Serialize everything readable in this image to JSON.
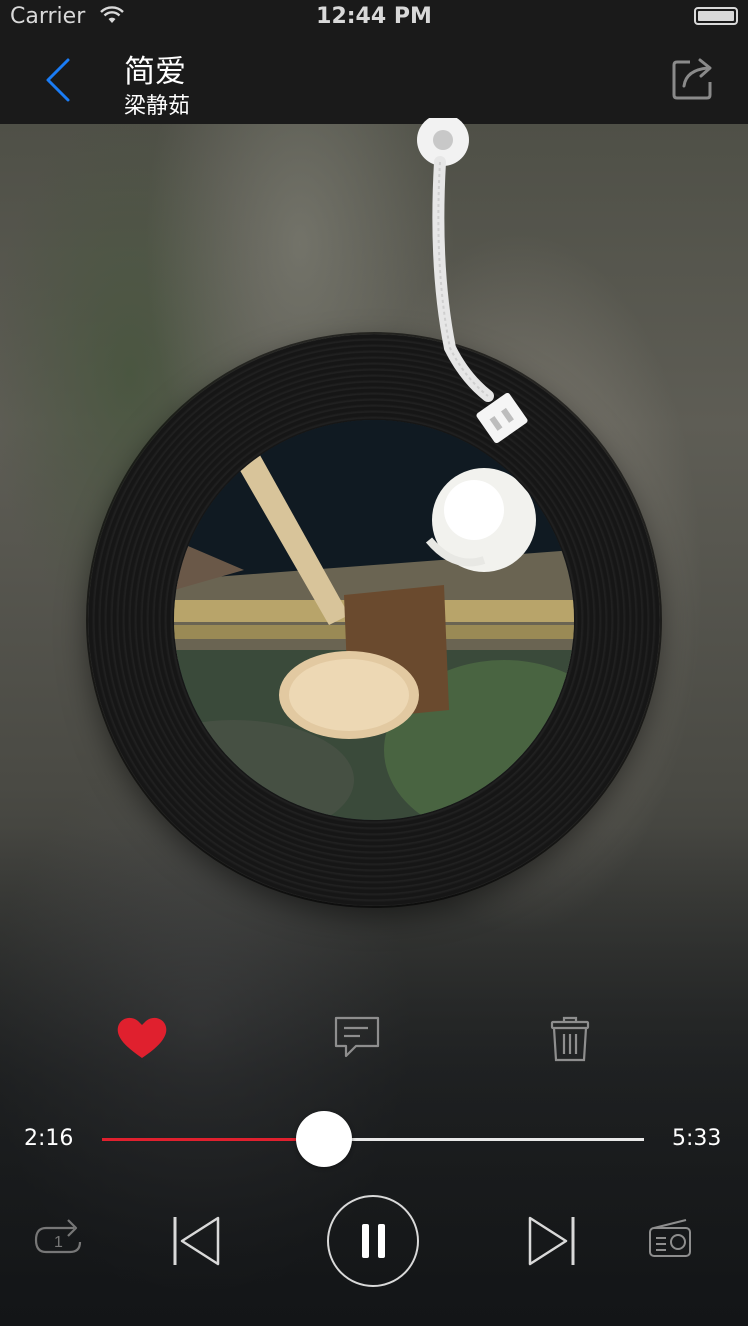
{
  "status_bar": {
    "carrier": "Carrier",
    "time": "12:44 PM"
  },
  "nav": {
    "back_icon": "chevron-left-icon",
    "title": "简爱",
    "subtitle": "梁静茹",
    "share_icon": "share-icon",
    "accent_color": "#1a7cf5"
  },
  "player": {
    "liked": true,
    "like_color": "#e0202e",
    "elapsed": "2:16",
    "duration": "5:33",
    "progress": 0.41,
    "state": "playing",
    "repeat_mode_badge": "1"
  }
}
